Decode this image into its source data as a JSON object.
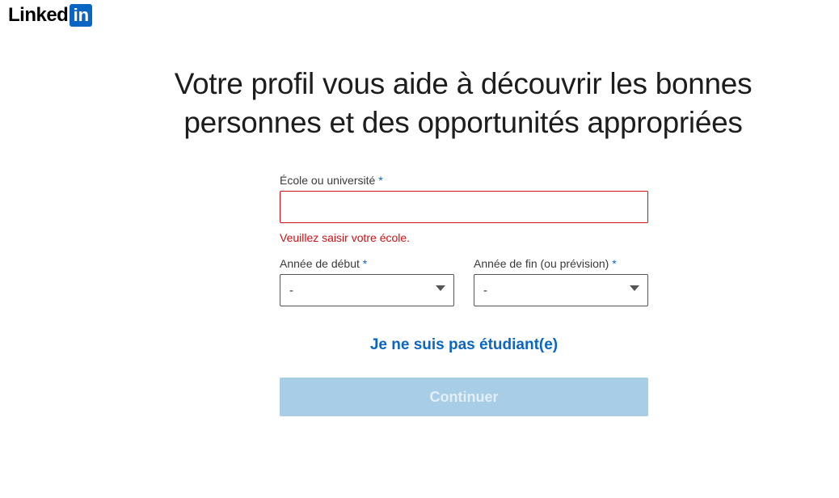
{
  "logo": {
    "text": "Linked",
    "box_text": "in",
    "brand_color": "#0a66c2"
  },
  "headline": {
    "line1": "Votre profil vous aide à découvrir les bonnes",
    "line2": "personnes et des opportunités appropriées"
  },
  "form": {
    "school": {
      "label": "École ou université",
      "required_marker": "*",
      "value": "",
      "error": "Veuillez saisir votre école.",
      "error_color": "#cc1016"
    },
    "start_year": {
      "label": "Année de début",
      "required_marker": "*",
      "selected": "-"
    },
    "end_year": {
      "label": "Année de fin (ou prévision)",
      "required_marker": "*",
      "selected": "-"
    },
    "not_student_link": "Je ne suis pas étudiant(e)",
    "continue_button": "Continuer",
    "continue_button_color": "#a8cde6"
  }
}
